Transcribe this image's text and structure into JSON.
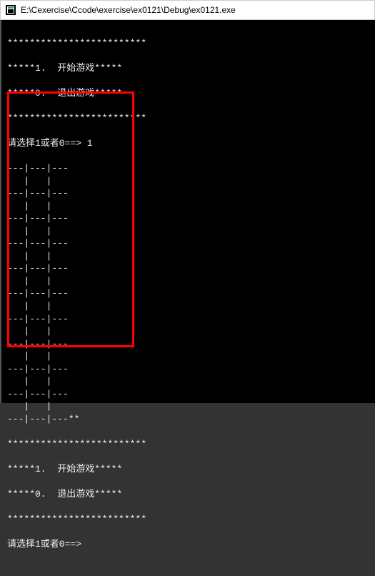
{
  "window": {
    "title": "E:\\Cexercise\\Ccode\\exercise\\ex0121\\Debug\\ex0121.exe"
  },
  "menu": {
    "border_top": "*************************",
    "opt_start": "*****1.  开始游戏*****",
    "opt_exit": "*****0.  退出游戏*****",
    "border_bot": "*************************",
    "prompt1": "请选择1或者0==> 1",
    "prompt2": "请选择1或者0==>"
  },
  "board": {
    "row_sep": "---|---|---",
    "row_cell": "   |   |   ",
    "row_sep_tail": "---|---|---**",
    "repeat": 10
  }
}
